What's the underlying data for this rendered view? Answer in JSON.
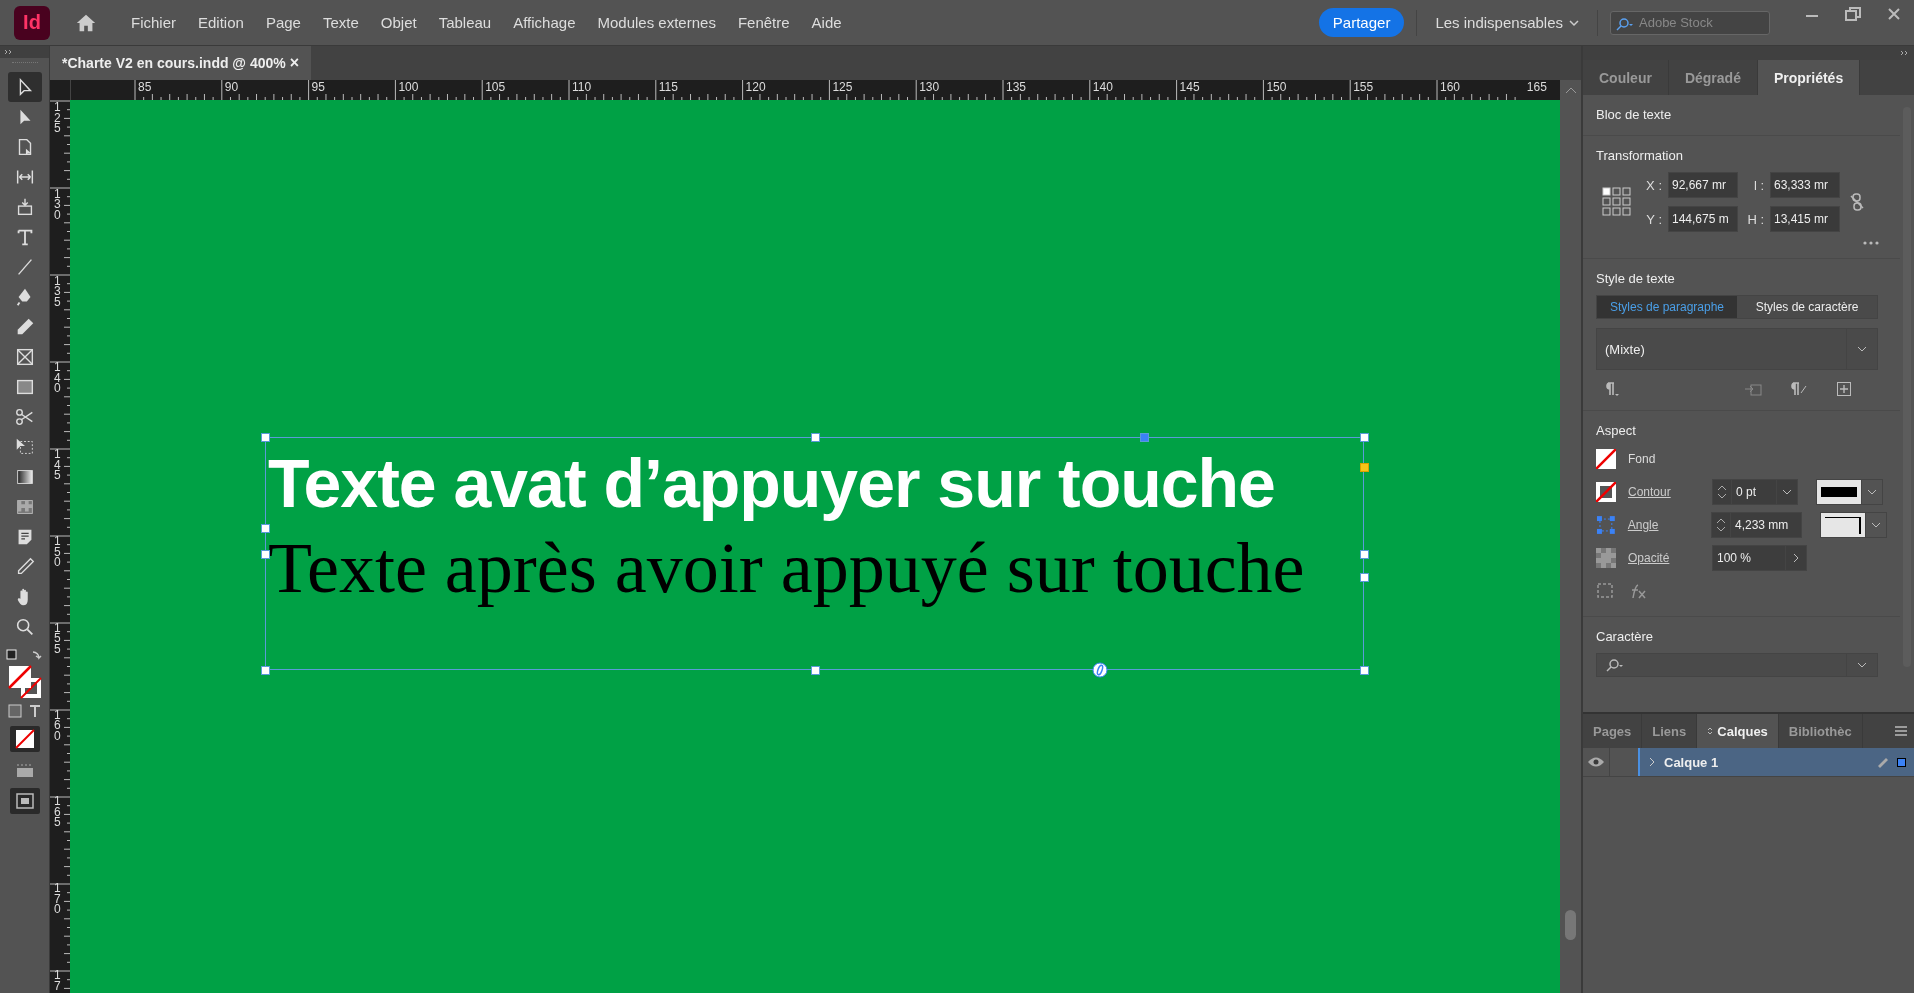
{
  "app": {
    "logo": "Id"
  },
  "menu": [
    "Fichier",
    "Edition",
    "Page",
    "Texte",
    "Objet",
    "Tableau",
    "Affichage",
    "Modules externes",
    "Fenêtre",
    "Aide"
  ],
  "share_button": "Partager",
  "workspace": "Les indispensables",
  "search": {
    "placeholder": "Adobe Stock"
  },
  "document_tab": {
    "title": "*Charte V2 en cours.indd @ 400%",
    "close": "×"
  },
  "ruler_h": [
    "85",
    "90",
    "95",
    "100",
    "105",
    "110",
    "115",
    "120",
    "125",
    "130",
    "135",
    "140",
    "145",
    "150",
    "155",
    "160",
    "165"
  ],
  "ruler_v": [
    "125",
    "130",
    "135",
    "140",
    "145",
    "150",
    "155",
    "160",
    "165",
    "170",
    "17"
  ],
  "tools": [
    {
      "kind": "selection",
      "selected": true
    },
    {
      "kind": "direct",
      "selected": false
    },
    {
      "kind": "page",
      "selected": false
    },
    {
      "kind": "gap",
      "selected": false
    },
    {
      "kind": "collector",
      "selected": false
    },
    {
      "kind": "type",
      "selected": false
    },
    {
      "kind": "line",
      "selected": false
    },
    {
      "kind": "pen",
      "selected": false
    },
    {
      "kind": "pencil",
      "selected": false
    },
    {
      "kind": "frame",
      "selected": false
    },
    {
      "kind": "rect",
      "selected": false
    },
    {
      "kind": "scissors",
      "selected": false
    },
    {
      "kind": "transform",
      "selected": false
    },
    {
      "kind": "gradient",
      "selected": false
    },
    {
      "kind": "feather",
      "selected": false
    },
    {
      "kind": "note",
      "selected": false
    },
    {
      "kind": "eyedropper",
      "selected": false
    },
    {
      "kind": "hand",
      "selected": false
    },
    {
      "kind": "zoom",
      "selected": false
    }
  ],
  "canvas": {
    "lines": [
      {
        "kind": "heading",
        "text": "Texte avat d’appuyer sur touche"
      },
      {
        "kind": "body",
        "text": "Texte après avoir appuyé sur touche"
      }
    ]
  },
  "properties_panel": {
    "tabs": [
      {
        "label": "Couleur",
        "selected": false
      },
      {
        "label": "Dégradé",
        "selected": false
      },
      {
        "label": "Propriétés",
        "selected": true
      }
    ],
    "object_type": "Bloc de texte",
    "transformation": {
      "title": "Transformation",
      "fields": [
        {
          "label": "X :",
          "value": "92,667 mr"
        },
        {
          "label": "l :",
          "value": "63,333 mr"
        },
        {
          "label": "Y :",
          "value": "144,675 m"
        },
        {
          "label": "H :",
          "value": "13,415 mr"
        }
      ]
    },
    "text_style": {
      "title": "Style de texte",
      "tabs": [
        {
          "label": "Styles de paragraphe",
          "selected": true
        },
        {
          "label": "Styles de caractère",
          "selected": false
        }
      ],
      "style": "(Mixte)"
    },
    "aspect": {
      "title": "Aspect",
      "fill": "Fond",
      "stroke": {
        "label": "Contour",
        "value": "0 pt"
      },
      "corner": {
        "label": "Angle",
        "value": "4,233 mm"
      },
      "opacity": {
        "label": "Opacité",
        "value": "100 %"
      }
    },
    "character": {
      "title": "Caractère"
    }
  },
  "layers_panel": {
    "tabs": [
      {
        "label": "Pages",
        "selected": false
      },
      {
        "label": "Liens",
        "selected": false
      },
      {
        "label": "Calques",
        "selected": true
      },
      {
        "label": "Bibliothèc",
        "selected": false
      }
    ],
    "layers": [
      {
        "name": "Calque 1",
        "visible": true,
        "selected": true,
        "expanded": false
      }
    ]
  }
}
